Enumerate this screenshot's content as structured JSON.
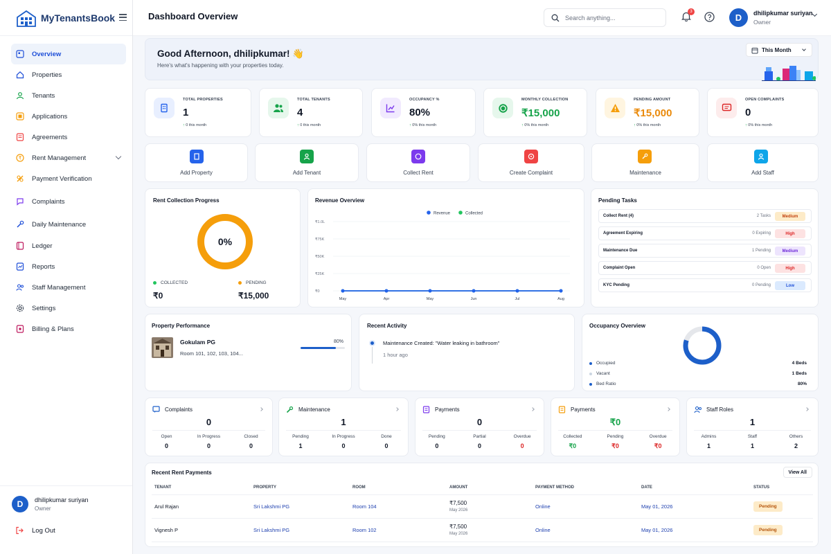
{
  "app": {
    "name": "MyTenantsBook"
  },
  "sidebar": {
    "items": [
      {
        "label": "Overview",
        "icon": "overview-icon"
      },
      {
        "label": "Properties",
        "icon": "home-icon"
      },
      {
        "label": "Tenants",
        "icon": "user-icon"
      },
      {
        "label": "Applications",
        "icon": "applications-icon"
      },
      {
        "label": "Agreements",
        "icon": "agreements-icon"
      },
      {
        "label": "Rent Management",
        "icon": "rent-icon"
      },
      {
        "label": "Payment Verification",
        "icon": "payment-verification-icon"
      },
      {
        "label": "Complaints",
        "icon": "complaints-icon"
      },
      {
        "label": "Daily Maintenance",
        "icon": "wrench-icon"
      },
      {
        "label": "Ledger",
        "icon": "ledger-icon"
      },
      {
        "label": "Reports",
        "icon": "reports-icon"
      },
      {
        "label": "Staff Management",
        "icon": "staff-icon"
      },
      {
        "label": "Settings",
        "icon": "gear-icon"
      },
      {
        "label": "Billing & Plans",
        "icon": "billing-icon"
      }
    ],
    "user": {
      "initial": "D",
      "name": "dhilipkumar suriyan",
      "role": "Owner"
    },
    "logout_label": "Log Out"
  },
  "header": {
    "title": "Dashboard Overview",
    "search_placeholder": "Search anything...",
    "notification_count": "3",
    "user": {
      "initial": "D",
      "name": "dhilipkumar suriyan",
      "role": "Owner"
    }
  },
  "greeting": {
    "title": "Good Afternoon, dhilipkumar! 👋",
    "subtitle": "Here's what's happening with your properties today.",
    "period": "This Month"
  },
  "stats": [
    {
      "label": "TOTAL PROPERTIES",
      "value": "1",
      "trend": "0 this month",
      "color": "#2563eb"
    },
    {
      "label": "TOTAL TENANTS",
      "value": "4",
      "trend": "0 this month",
      "color": "#16a34a"
    },
    {
      "label": "OCCUPANCY %",
      "value": "80%",
      "trend": "0% this month",
      "color": "#7c3aed"
    },
    {
      "label": "MONTHLY COLLECTION",
      "value": "₹15,000",
      "trend": "0% this month",
      "color": "#16a34a"
    },
    {
      "label": "PENDING AMOUNT",
      "value": "₹15,000",
      "trend": "0% this month",
      "color": "#f59e0b"
    },
    {
      "label": "OPEN COMPLAINTS",
      "value": "0",
      "trend": "0% this month",
      "color": "#dc2626"
    }
  ],
  "quick_actions": [
    {
      "label": "Add Property",
      "color": "#2563eb"
    },
    {
      "label": "Add Tenant",
      "color": "#16a34a"
    },
    {
      "label": "Collect Rent",
      "color": "#7c3aed"
    },
    {
      "label": "Create Complaint",
      "color": "#ef4444"
    },
    {
      "label": "Maintenance",
      "color": "#f59e0b"
    },
    {
      "label": "Add Staff",
      "color": "#0ea5e9"
    }
  ],
  "rent_progress": {
    "title": "Rent Collection Progress",
    "percent_label": "0%",
    "collected_fraction": 0,
    "collected_label": "COLLECTED",
    "collected_value": "₹0",
    "pending_label": "PENDING",
    "pending_value": "₹15,000"
  },
  "revenue": {
    "title": "Revenue Overview",
    "chart_data": {
      "type": "line",
      "x": [
        "May",
        "Apr",
        "May",
        "Jun",
        "Jul",
        "Aug"
      ],
      "series": [
        {
          "name": "Revenue",
          "values": [
            0,
            0,
            0,
            0,
            0,
            0
          ],
          "color": "#2563eb"
        },
        {
          "name": "Collected",
          "values": [
            0,
            0,
            0,
            0,
            0,
            0
          ],
          "color": "#22c55e"
        }
      ],
      "yticks": [
        "₹0",
        "₹25K",
        "₹50K",
        "₹75K",
        "₹1.0L"
      ],
      "ylim": [
        0,
        100000
      ],
      "legend": "top-center"
    }
  },
  "pending_tasks": {
    "title": "Pending Tasks",
    "items": [
      {
        "name": "Collect Rent (4)",
        "count": "2 Tasks",
        "priority": "Medium"
      },
      {
        "name": "Agreement Expiring",
        "count": "0 Expiring",
        "priority": "High"
      },
      {
        "name": "Maintenance Due",
        "count": "1 Pending",
        "priority": "Medium"
      },
      {
        "name": "Complaint Open",
        "count": "0 Open",
        "priority": "High"
      },
      {
        "name": "KYC Pending",
        "count": "0 Pending",
        "priority": "Low"
      }
    ]
  },
  "property_performance": {
    "title": "Property Performance",
    "name": "Gokulam PG",
    "rooms": "Room 101, 102, 103, 104...",
    "percent_label": "80%",
    "fraction": 0.8
  },
  "recent_activity": {
    "title": "Recent Activity",
    "items": [
      {
        "text": "Maintenance Created: \"Water leaking in bathroom\"",
        "time": "1 hour ago"
      }
    ]
  },
  "occupancy_overview": {
    "title": "Occupancy Overview",
    "occupied_fraction": 0.8,
    "items": [
      {
        "label": "Occupied",
        "value": "4 Beds",
        "color": "#1d5fc9"
      },
      {
        "label": "Vacant",
        "value": "1 Beds",
        "color": "#cbd5e1"
      },
      {
        "label": "Bed Ratio",
        "value": "80%",
        "color": "#1d5fc9"
      }
    ]
  },
  "mini_cards": [
    {
      "title": "Complaints",
      "value": "0",
      "subs": [
        {
          "label": "Open",
          "value": "0"
        },
        {
          "label": "In Progress",
          "value": "0"
        },
        {
          "label": "Closed",
          "value": "0"
        }
      ]
    },
    {
      "title": "Maintenance",
      "value": "1",
      "subs": [
        {
          "label": "Pending",
          "value": "1"
        },
        {
          "label": "In Progress",
          "value": "0"
        },
        {
          "label": "Done",
          "value": "0"
        }
      ]
    },
    {
      "title": "Payments",
      "value": "0",
      "subs": [
        {
          "label": "Pending",
          "value": "0"
        },
        {
          "label": "Partial",
          "value": "0"
        },
        {
          "label": "Overdue",
          "value": "0"
        }
      ]
    },
    {
      "title": "Payments",
      "value": "₹0",
      "subs": [
        {
          "label": "Collected",
          "value": "₹0"
        },
        {
          "label": "Pending",
          "value": "₹0"
        },
        {
          "label": "Overdue",
          "value": "₹0"
        }
      ]
    },
    {
      "title": "Staff Roles",
      "value": "1",
      "subs": [
        {
          "label": "Admins",
          "value": "1"
        },
        {
          "label": "Staff",
          "value": "1"
        },
        {
          "label": "Others",
          "value": "2"
        }
      ]
    }
  ],
  "recent_payments": {
    "title": "Recent Rent Payments",
    "view_all": "View All",
    "columns": [
      "TENANT",
      "PROPERTY",
      "ROOM",
      "AMOUNT",
      "PAYMENT METHOD",
      "DATE",
      "STATUS"
    ],
    "rows": [
      {
        "tenant": "Arul Rajan",
        "property": "Sri Lakshmi PG",
        "room": "Room 104",
        "amount": "₹7,500",
        "period": "May 2026",
        "method": "Online",
        "date": "May 01, 2026",
        "status": "Pending"
      },
      {
        "tenant": "Vignesh P",
        "property": "Sri Lakshmi PG",
        "room": "Room 102",
        "amount": "₹7,500",
        "period": "May 2026",
        "method": "Online",
        "date": "May 01, 2026",
        "status": "Pending"
      }
    ]
  }
}
